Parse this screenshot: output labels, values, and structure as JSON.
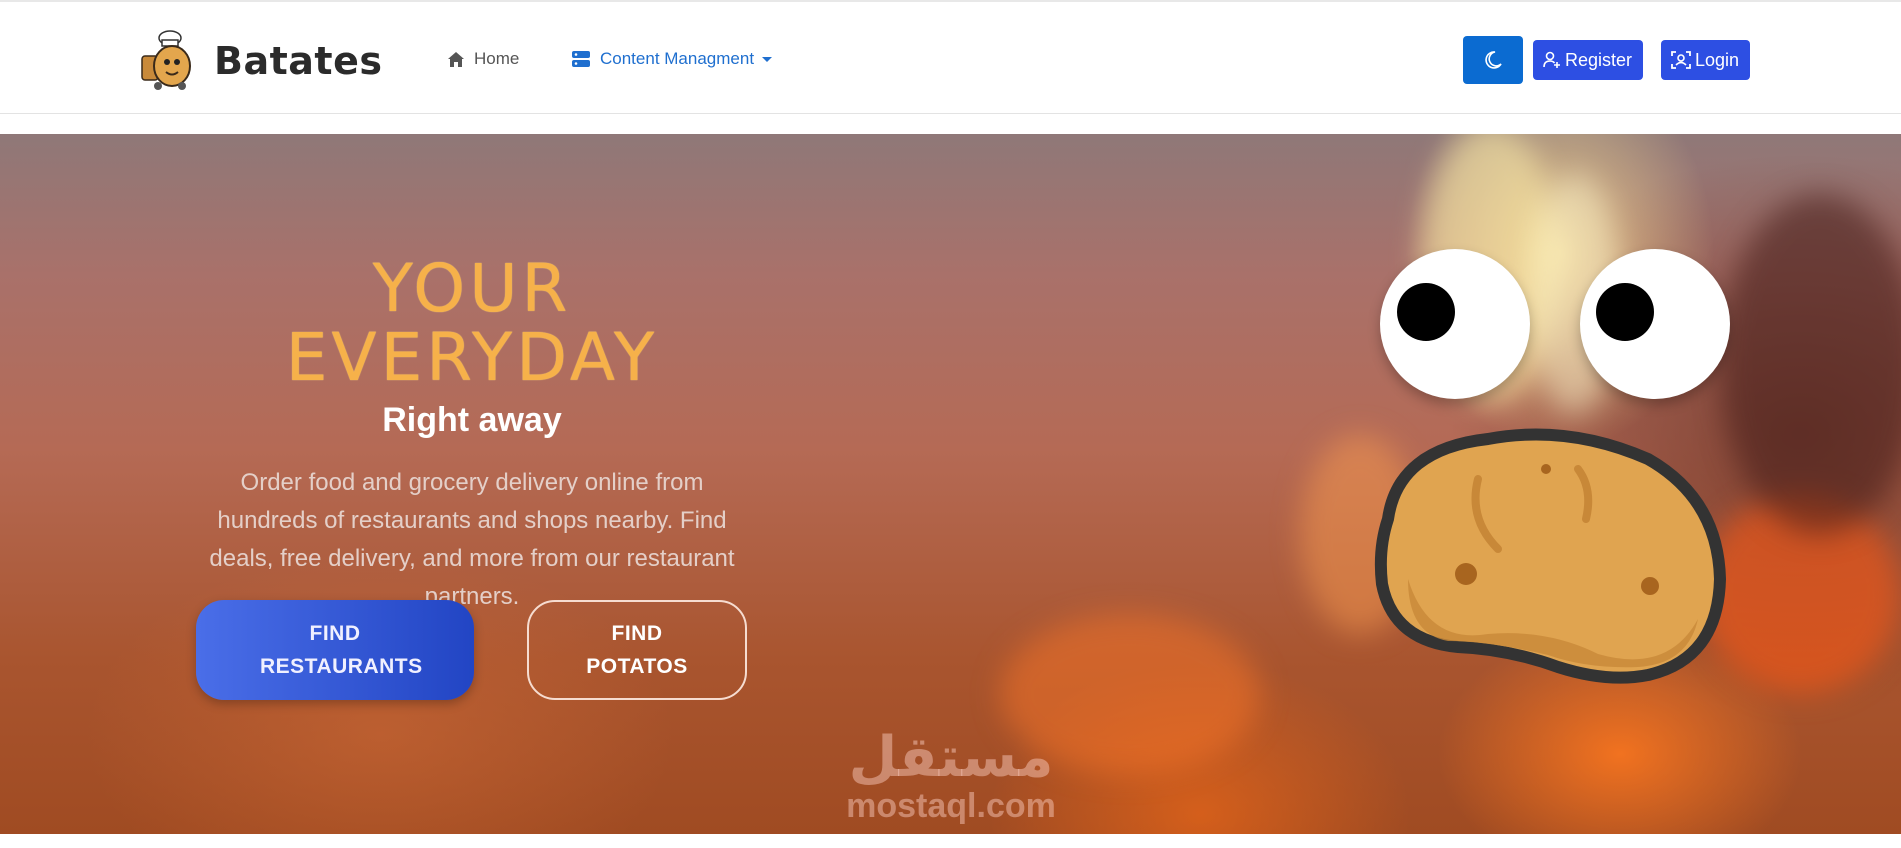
{
  "navbar": {
    "brand_name": "Batates",
    "links": {
      "home": "Home",
      "content": "Content Managment"
    },
    "buttons": {
      "register": "Register",
      "login": "Login"
    }
  },
  "hero": {
    "title": "YOUR EVERYDAY",
    "subtitle": "Right away",
    "description": "Order food and grocery delivery online from hundreds of restaurants and shops nearby. Find deals, free delivery, and more from our restaurant partners.",
    "buttons": {
      "find_restaurants": "FIND RESTAURANTS",
      "find_potatos": "FIND POTATOS"
    }
  },
  "watermark": {
    "arabic": "مستقل",
    "latin": "mostaql.com"
  },
  "colors": {
    "primary_button": "#2d4fe3",
    "theme_button": "#0b6bd1",
    "hero_title": "#f6b14a",
    "nav_active": "#1f6fcf"
  },
  "icons": {
    "home": "home-icon",
    "content": "server-icon",
    "theme": "moon-icon",
    "register": "user-plus-icon",
    "login": "user-scan-icon"
  }
}
